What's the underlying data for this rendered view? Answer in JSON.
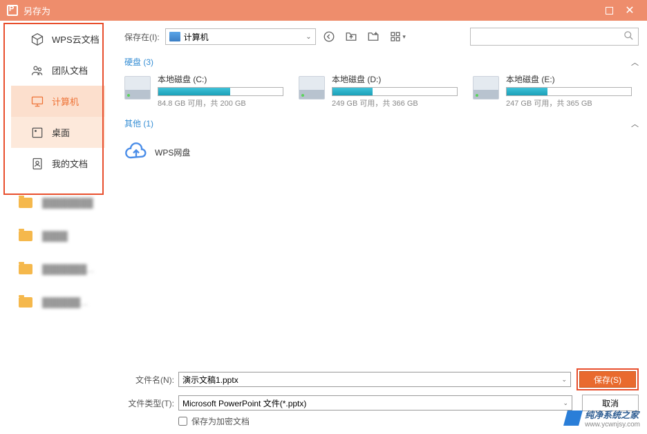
{
  "title": "另存为",
  "sidebar": {
    "items": [
      {
        "label": "WPS云文档"
      },
      {
        "label": "团队文档"
      },
      {
        "label": "计算机"
      },
      {
        "label": "桌面"
      },
      {
        "label": "我的文档"
      }
    ]
  },
  "toolbar": {
    "location_label": "保存在(I):",
    "location_value": "计算机"
  },
  "sections": {
    "disk_label": "硬盘 (3)",
    "other_label": "其他 (1)"
  },
  "drives": [
    {
      "name": "本地磁盘 (C:)",
      "fill": 58,
      "text": "84.8 GB 可用，共 200 GB"
    },
    {
      "name": "本地磁盘 (D:)",
      "fill": 32,
      "text": "249 GB 可用，共 366 GB"
    },
    {
      "name": "本地磁盘 (E:)",
      "fill": 33,
      "text": "247 GB 可用，共 365 GB"
    }
  ],
  "cloud": {
    "label": "WPS网盘"
  },
  "form": {
    "filename_label": "文件名(N):",
    "filename_value": "演示文稿1.pptx",
    "filetype_label": "文件类型(T):",
    "filetype_value": "Microsoft PowerPoint 文件(*.pptx)",
    "save_label": "保存(S)",
    "cancel_label": "取消",
    "encrypt_label": "保存为加密文档"
  },
  "watermark": {
    "main": "纯净系统之家",
    "sub": "www.ycwnjsy.com"
  }
}
